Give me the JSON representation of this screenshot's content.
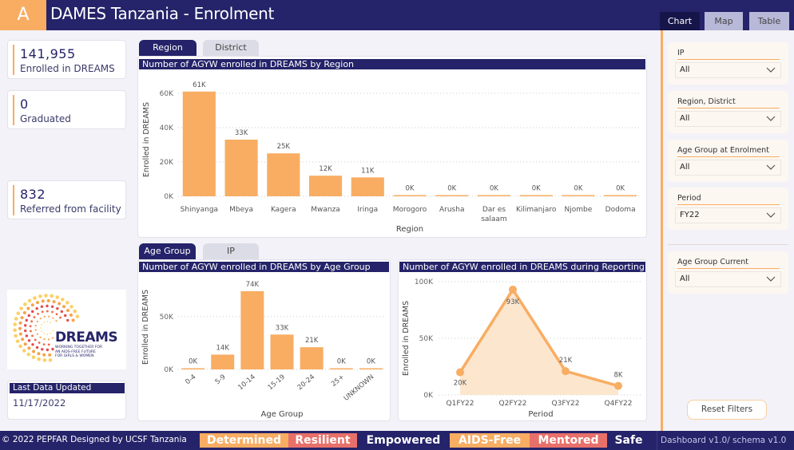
{
  "header": {
    "logo_letter": "A",
    "title": "DAMES Tanzania - Enrolment",
    "view_tabs": [
      {
        "label": "Chart",
        "active": true
      },
      {
        "label": "Map",
        "active": false
      },
      {
        "label": "Table",
        "active": false
      }
    ]
  },
  "kpis": [
    {
      "value": "141,955",
      "label": "Enrolled in DREAMS"
    },
    {
      "value": "0",
      "label": "Graduated"
    },
    {
      "value": "832",
      "label": "Referred from facility"
    }
  ],
  "logo": {
    "name": "DREAMS",
    "tagline_lines": [
      "WORKING TOGETHER FOR",
      "AN AIDS-FREE FUTURE",
      "FOR GIRLS & WOMEN"
    ],
    "icon": "dreams-sunburst-logo"
  },
  "last_updated": {
    "label": "Last Data Updated",
    "value": "11/17/2022"
  },
  "region_tabs": [
    {
      "label": "Region",
      "active": true
    },
    {
      "label": "District",
      "active": false
    }
  ],
  "age_tabs": [
    {
      "label": "Age Group",
      "active": true
    },
    {
      "label": "IP",
      "active": false
    }
  ],
  "colors": {
    "navy": "#252369",
    "orange": "#f8ad63",
    "coral": "#e8706a",
    "area_fill": "#fde3c9"
  },
  "chart_data": [
    {
      "type": "bar",
      "title": "Number of AGYW enrolled in DREAMS by Region",
      "xlabel": "Region",
      "ylabel": "Enrolled in DREAMS",
      "categories": [
        "Shinyanga",
        "Mbeya",
        "Kagera",
        "Mwanza",
        "Iringa",
        "Morogoro",
        "Arusha",
        "Dar es salaam",
        "Kilimanjaro",
        "Njombe",
        "Dodoma"
      ],
      "values": [
        61000,
        33000,
        25000,
        12000,
        11000,
        0,
        0,
        0,
        0,
        0,
        0
      ],
      "data_labels": [
        "61K",
        "33K",
        "25K",
        "12K",
        "11K",
        "0K",
        "0K",
        "0K",
        "0K",
        "0K",
        "0K"
      ],
      "yticks": [
        0,
        20000,
        40000,
        60000
      ],
      "ytick_labels": [
        "0K",
        "20K",
        "40K",
        "60K"
      ],
      "ylim": [
        0,
        66000
      ],
      "grid": true
    },
    {
      "type": "bar",
      "title": "Number of AGYW enrolled in DREAMS by Age Group",
      "xlabel": "Age Group",
      "ylabel": "Enrolled in DREAMS",
      "categories": [
        "0-4",
        "5-9",
        "10-14",
        "15-19",
        "20-24",
        "25+",
        "UNKNOWN"
      ],
      "values": [
        0,
        14000,
        74000,
        33000,
        21000,
        0,
        0
      ],
      "data_labels": [
        "0K",
        "14K",
        "74K",
        "33K",
        "21K",
        "0K",
        "0K"
      ],
      "yticks": [
        0,
        50000
      ],
      "ytick_labels": [
        "0K",
        "50K"
      ],
      "ylim": [
        0,
        80000
      ],
      "grid": true
    },
    {
      "type": "area",
      "title": "Number of AGYW enrolled in DREAMS during Reporting Period",
      "xlabel": "Period",
      "ylabel": "Enrolled in DREAMS",
      "x": [
        "Q1FY22",
        "Q2FY22",
        "Q3FY22",
        "Q4FY22"
      ],
      "values": [
        20000,
        93000,
        21000,
        8000
      ],
      "data_labels": [
        "20K",
        "93K",
        "21K",
        "8K"
      ],
      "yticks": [
        0,
        50000,
        100000
      ],
      "ytick_labels": [
        "0K",
        "50K",
        "100K"
      ],
      "ylim": [
        0,
        100000
      ],
      "grid": true
    }
  ],
  "filters": [
    {
      "label": "IP",
      "value": "All"
    },
    {
      "label": "Region, District",
      "value": "All"
    },
    {
      "label": "Age Group at Enrolment",
      "value": "All"
    },
    {
      "label": "Period",
      "value": "FY22"
    },
    {
      "label": "Age Group Current",
      "value": "All"
    }
  ],
  "reset_button": "Reset Filters",
  "footer": {
    "copyright": "© 2022 PEPFAR Designed by UCSF Tanzania",
    "tags": [
      {
        "label": "Determined",
        "color": "#f8ad63"
      },
      {
        "label": "Resilient",
        "color": "#e8706a"
      },
      {
        "label": "Empowered",
        "color": ""
      },
      {
        "label": "AIDS-Free",
        "color": "#f8ad63"
      },
      {
        "label": "Mentored",
        "color": "#e8706a"
      },
      {
        "label": "Safe",
        "color": ""
      }
    ],
    "version": "Dashboard v1.0/ schema v1.0"
  }
}
